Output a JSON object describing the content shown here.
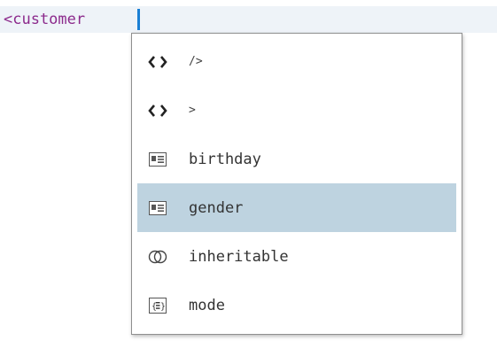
{
  "editor": {
    "line_text": "<customer "
  },
  "completion": {
    "items": [
      {
        "label": "/>",
        "icon": "tag-icon",
        "selected": false
      },
      {
        "label": ">",
        "icon": "tag-icon",
        "selected": false
      },
      {
        "label": "birthday",
        "icon": "element-icon",
        "selected": false
      },
      {
        "label": "gender",
        "icon": "element-icon",
        "selected": true
      },
      {
        "label": "inheritable",
        "icon": "attribute-icon",
        "selected": false
      },
      {
        "label": "mode",
        "icon": "enum-icon",
        "selected": false
      }
    ]
  },
  "colors": {
    "line_highlight": "#eef3f8",
    "selection": "#bed3e0",
    "caret": "#1a7fd4",
    "tag_text": "#8c2a8c"
  }
}
